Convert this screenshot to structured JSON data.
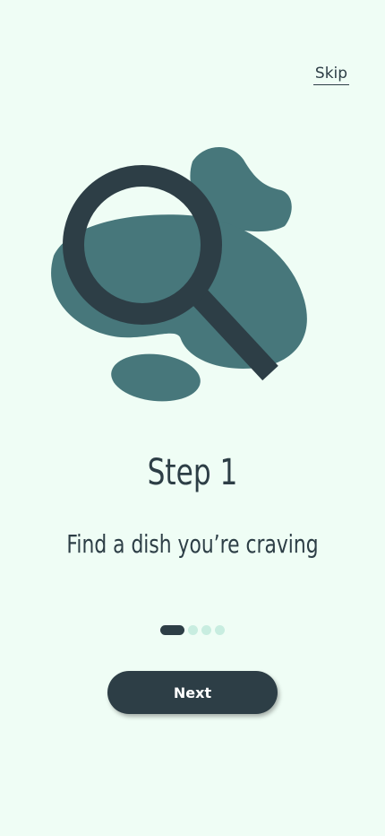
{
  "header": {
    "skip_label": "Skip"
  },
  "onboarding": {
    "step_title": "Step 1",
    "step_subtitle": "Find a dish you’re craving",
    "illustration_icon": "magnifying-glass-icon",
    "progress": {
      "current": 1,
      "total": 4
    }
  },
  "footer": {
    "next_label": "Next"
  },
  "colors": {
    "background": "#effdf5",
    "primary": "#2d3e46",
    "blob": "#47777b",
    "dot_inactive": "#c8ede0"
  }
}
